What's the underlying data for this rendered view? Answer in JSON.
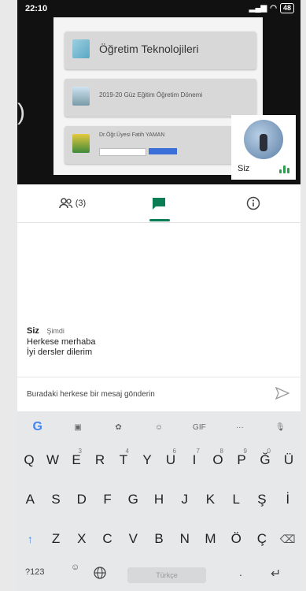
{
  "status": {
    "time": "22:10",
    "battery": "48"
  },
  "presentation": {
    "cards": [
      {
        "label": "Öğretim Teknolojileri"
      },
      {
        "label": "2019-20 Güz Eğitim Öğretim Dönemi"
      },
      {
        "label": "Dr.Öğr.Üyesi Fatih YAMAN"
      }
    ],
    "self": {
      "name": "Siz"
    }
  },
  "tabs": {
    "people_count": "(3)"
  },
  "chat": {
    "messages": [
      {
        "sender": "Siz",
        "time": "Şimdi",
        "lines": [
          "Herkese merhaba",
          "İyi dersler dilerim"
        ]
      }
    ],
    "input_placeholder": "Buradaki herkese bir mesaj gönderin"
  },
  "keyboard": {
    "toolbar": [
      "G",
      "sticker",
      "palette",
      "emoji",
      "GIF",
      "···",
      "mic"
    ],
    "gif_label": "GIF",
    "more_label": "···",
    "row1": [
      "Q",
      "W",
      "E",
      "R",
      "T",
      "Y",
      "U",
      "I",
      "O",
      "P",
      "Ğ",
      "Ü"
    ],
    "row1_hints": [
      "",
      "",
      "3",
      "",
      "4",
      "",
      "6",
      "7",
      "8",
      "9",
      "0",
      ""
    ],
    "row2": [
      "A",
      "S",
      "D",
      "F",
      "G",
      "H",
      "J",
      "K",
      "L",
      "Ş",
      "İ"
    ],
    "row3": [
      "Z",
      "X",
      "C",
      "V",
      "B",
      "N",
      "M",
      "Ö",
      "Ç"
    ],
    "numbers_label": "?123",
    "space_label": "Türkçe",
    "period_label": "."
  },
  "colors": {
    "accent": "#0b7d55",
    "keyboard_bg": "#e7e8ea",
    "shift": "#4a86e8"
  }
}
